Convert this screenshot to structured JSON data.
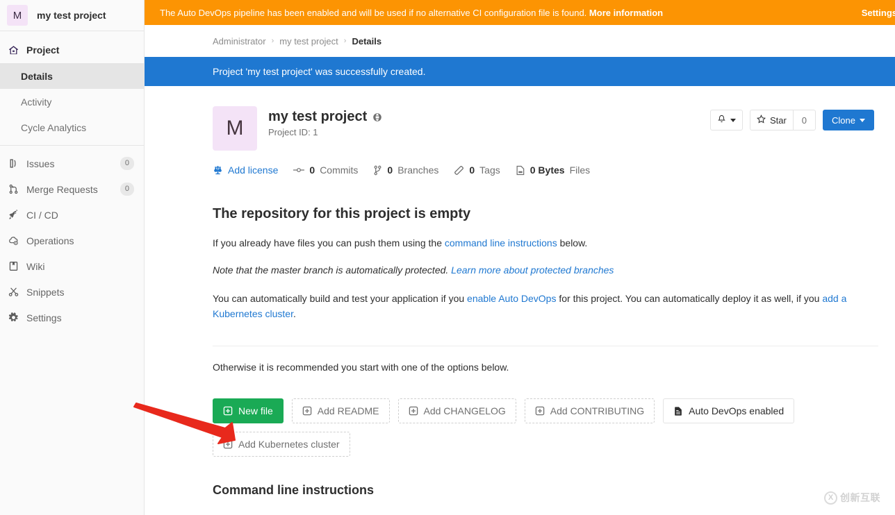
{
  "sidebar": {
    "avatar_initial": "M",
    "project_name": "my test project",
    "top_item": {
      "label": "Project",
      "icon": "home-icon"
    },
    "sub_items": [
      {
        "label": "Details",
        "active": true
      },
      {
        "label": "Activity",
        "active": false
      },
      {
        "label": "Cycle Analytics",
        "active": false
      }
    ],
    "items": [
      {
        "label": "Issues",
        "badge": "0",
        "icon": "issues-icon"
      },
      {
        "label": "Merge Requests",
        "badge": "0",
        "icon": "merge-request-icon"
      },
      {
        "label": "CI / CD",
        "badge": "",
        "icon": "rocket-icon"
      },
      {
        "label": "Operations",
        "badge": "",
        "icon": "cloud-gear-icon"
      },
      {
        "label": "Wiki",
        "badge": "",
        "icon": "book-icon"
      },
      {
        "label": "Snippets",
        "badge": "",
        "icon": "scissors-icon"
      },
      {
        "label": "Settings",
        "badge": "",
        "icon": "gear-icon"
      }
    ]
  },
  "devops_banner": {
    "message": "The Auto DevOps pipeline has been enabled and will be used if no alternative CI configuration file is found.",
    "more_link": "More information",
    "settings_link": "Settings",
    "background_color": "#fc9403"
  },
  "breadcrumb": {
    "items": [
      "Administrator",
      "my test project"
    ],
    "current": "Details",
    "separator": "›"
  },
  "flash": {
    "message": "Project 'my test project' was successfully created.",
    "background_color": "#1f78d1"
  },
  "project": {
    "avatar_initial": "M",
    "name": "my test project",
    "visibility_icon": "globe-icon",
    "project_id_label": "Project ID: 1",
    "notification_icon": "bell-icon",
    "star_label": "Star",
    "star_count": "0",
    "clone_label": "Clone"
  },
  "stats": [
    {
      "icon": "balance-scale-icon",
      "num": "",
      "label": "Add license",
      "link": true
    },
    {
      "icon": "commit-icon",
      "num": "0",
      "label": "Commits",
      "link": false
    },
    {
      "icon": "branch-icon",
      "num": "0",
      "label": "Branches",
      "link": false
    },
    {
      "icon": "tag-icon",
      "num": "0",
      "label": "Tags",
      "link": false
    },
    {
      "icon": "file-icon",
      "num": "0 Bytes",
      "label": "Files",
      "link": false
    }
  ],
  "empty_repo": {
    "title": "The repository for this project is empty",
    "push_text_before": "If you already have files you can push them using the ",
    "push_link": "command line instructions",
    "push_text_after": " below.",
    "note_before": "Note that the master branch is automatically protected. ",
    "note_link": "Learn more about protected branches",
    "devops_before": "You can automatically build and test your application if you ",
    "devops_link": "enable Auto DevOps",
    "devops_middle": " for this project. You can automatically deploy it as well, if you ",
    "devops_link2": "add a Kubernetes cluster",
    "devops_after": ".",
    "otherwise": "Otherwise it is recommended you start with one of the options below."
  },
  "action_buttons": [
    {
      "label": "New file",
      "style": "green",
      "icon": "plus-square-icon"
    },
    {
      "label": "Add README",
      "style": "dashed",
      "icon": "plus-square-icon"
    },
    {
      "label": "Add CHANGELOG",
      "style": "dashed",
      "icon": "plus-square-icon"
    },
    {
      "label": "Add CONTRIBUTING",
      "style": "dashed",
      "icon": "plus-square-icon"
    },
    {
      "label": "Auto DevOps enabled",
      "style": "solid",
      "icon": "doc-icon"
    },
    {
      "label": "Add Kubernetes cluster",
      "style": "dashed",
      "icon": "plus-square-icon"
    }
  ],
  "cli": {
    "title": "Command line instructions"
  },
  "watermark": {
    "mark": "X",
    "text": "创新互联"
  },
  "annotation": {
    "arrow_color": "#e8291c"
  }
}
